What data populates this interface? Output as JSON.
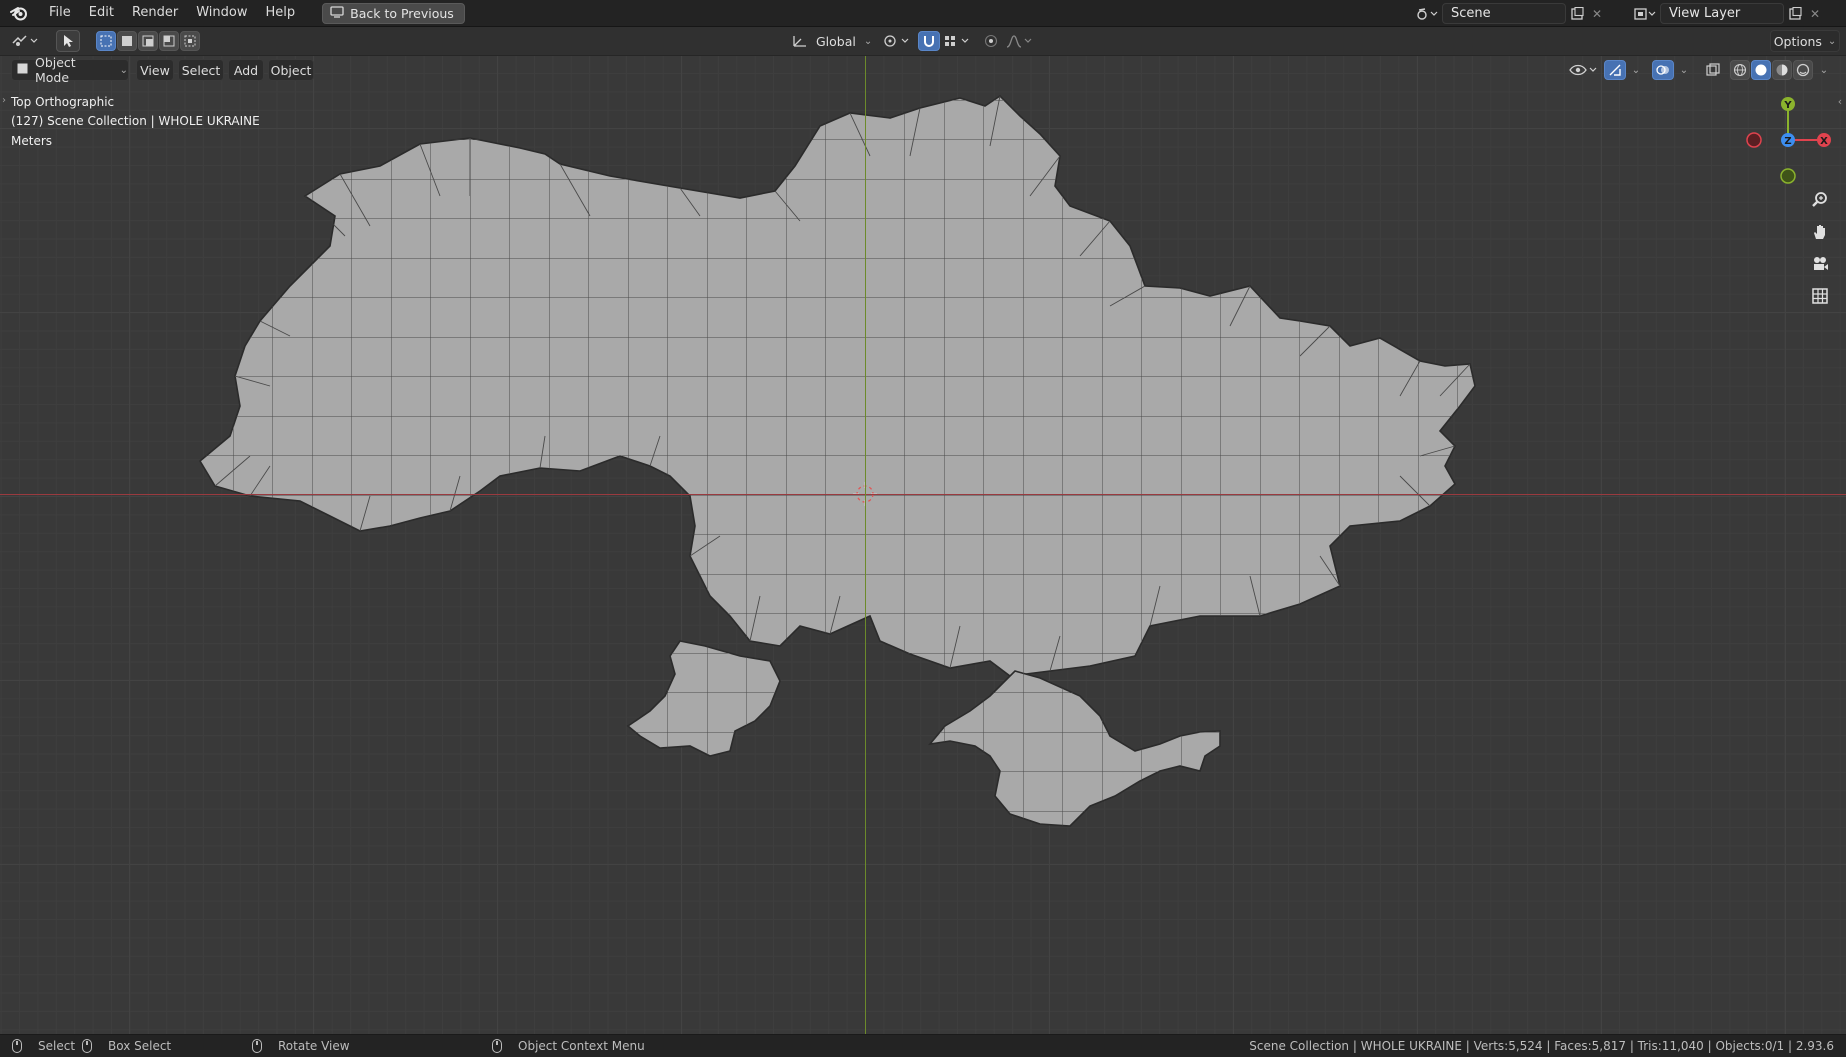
{
  "menu": {
    "items": [
      "File",
      "Edit",
      "Render",
      "Window",
      "Help"
    ],
    "back_button": "Back to Previous"
  },
  "scene": {
    "name": "Scene",
    "view_layer": "View Layer"
  },
  "header": {
    "transform_orientation": "Global",
    "options_label": "Options"
  },
  "modebar": {
    "mode": "Object Mode",
    "menus": [
      "View",
      "Select",
      "Add",
      "Object"
    ]
  },
  "viewport": {
    "view_name": "Top Orthographic",
    "collection_info": "(127) Scene Collection | WHOLE UKRAINE",
    "units": "Meters",
    "gizmo": {
      "x": "X",
      "y": "Y",
      "z": "Z"
    },
    "colors": {
      "x_axis": "#e0434e",
      "y_axis": "#8bb32d",
      "z_axis": "#3d8ef0",
      "mesh_fill": "#a9a9a9"
    }
  },
  "statusbar": {
    "select": "Select",
    "box_select": "Box Select",
    "rotate_view": "Rotate View",
    "context_menu": "Object Context Menu",
    "stats": "Scene Collection | WHOLE UKRAINE | Verts:5,524 | Faces:5,817 | Tris:11,040 | Objects:0/1 | 2.93.6"
  }
}
